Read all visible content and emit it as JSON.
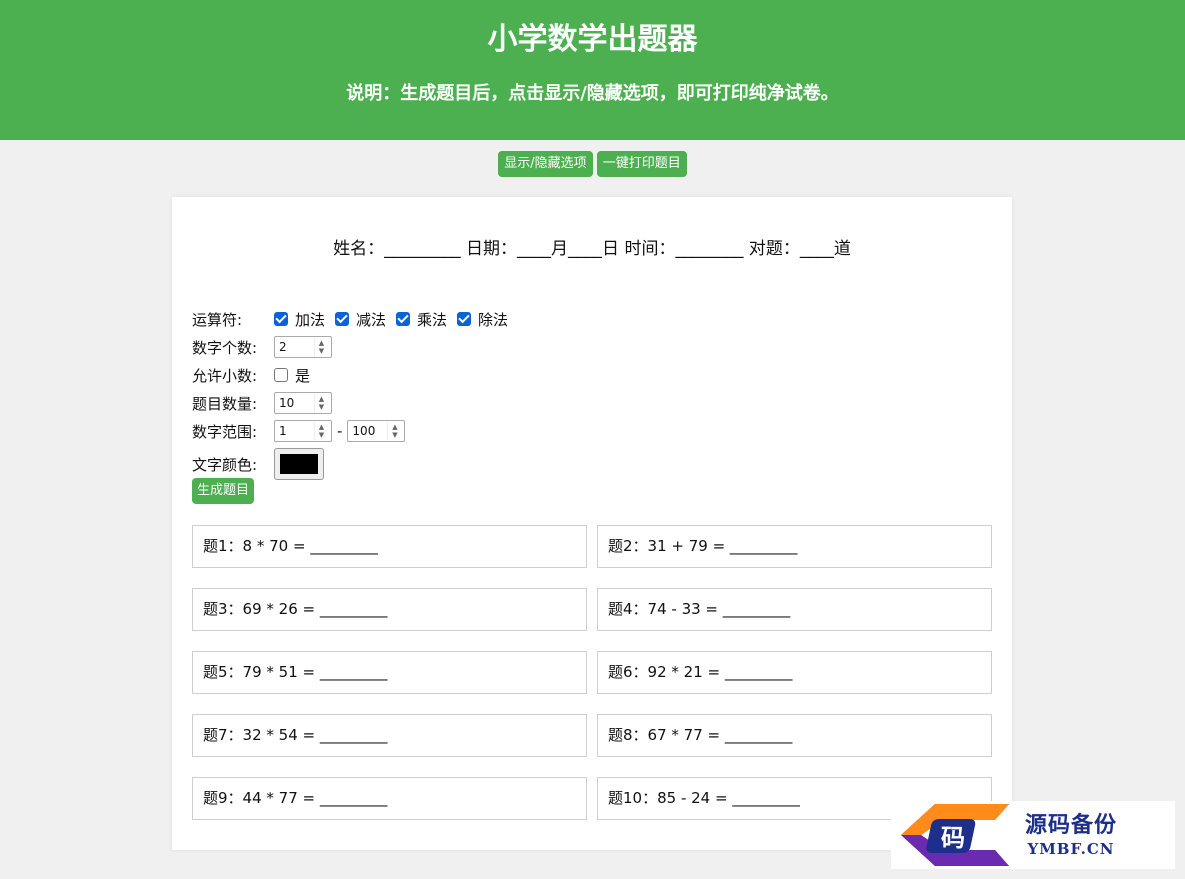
{
  "header": {
    "title": "小学数学出题器",
    "description": "说明：生成题目后，点击显示/隐藏选项，即可打印纯净试卷。"
  },
  "toolbar": {
    "toggle_label": "显示/隐藏选项",
    "print_label": "一键打印题目"
  },
  "info_line": "姓名：_________ 日期：____月____日 时间：________ 对题：____道",
  "options": {
    "operators": {
      "label": "运算符:",
      "items": [
        {
          "label": "加法",
          "checked": true
        },
        {
          "label": "减法",
          "checked": true
        },
        {
          "label": "乘法",
          "checked": true
        },
        {
          "label": "除法",
          "checked": true
        }
      ]
    },
    "number_count": {
      "label": "数字个数:",
      "value": "2"
    },
    "allow_decimal": {
      "label": "允许小数:",
      "option_label": "是",
      "checked": false
    },
    "question_count": {
      "label": "题目数量:",
      "value": "10"
    },
    "range": {
      "label": "数字范围:",
      "min": "1",
      "separator": "-",
      "max": "100"
    },
    "text_color": {
      "label": "文字颜色:",
      "value": "#000000"
    }
  },
  "generate_label": "生成题目",
  "questions": [
    "题1：8 * 70 = _________",
    "题2：31 + 79 = _________",
    "题3：69 * 26 = _________",
    "题4：74 - 33 = _________",
    "题5：79 * 51 = _________",
    "题6：92 * 21 = _________",
    "题7：32 * 54 = _________",
    "题8：67 * 77 = _________",
    "题9：44 * 77 = _________",
    "题10：85 - 24 = _________"
  ],
  "watermark": {
    "logo_char": "码",
    "cn": "源码备份",
    "en": "YMBF.CN"
  },
  "colors": {
    "accent": "#4caf50",
    "checkbox": "#0b63d8",
    "watermark_text": "#1d2f8a"
  }
}
